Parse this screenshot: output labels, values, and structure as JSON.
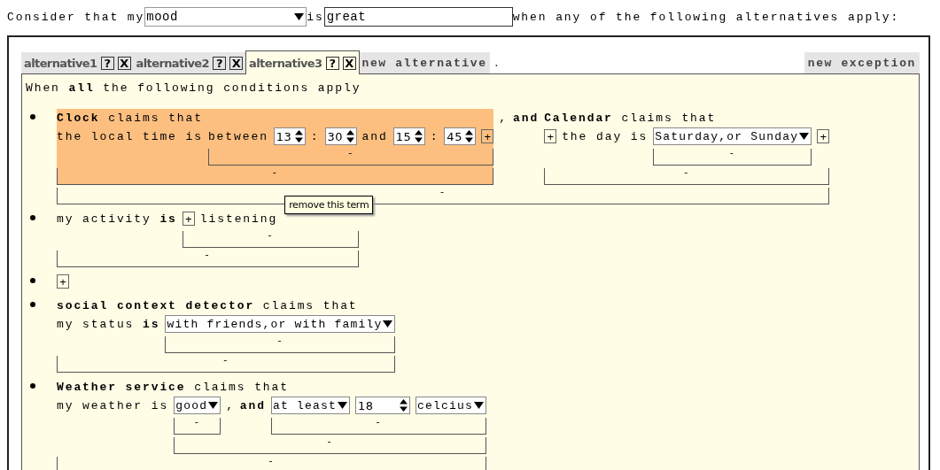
{
  "header": {
    "prefix": "Consider that my",
    "subject": "mood",
    "verb": "is",
    "value": "great",
    "suffix": "when any of the following alternatives apply:"
  },
  "tabs": [
    {
      "label": "alternative1",
      "help": "?",
      "close": "X",
      "selected": false
    },
    {
      "label": "alternative2",
      "help": "?",
      "close": "X",
      "selected": false
    },
    {
      "label": "alternative3",
      "help": "?",
      "close": "X",
      "selected": true
    }
  ],
  "new_alternative": "new alternative",
  "tab_dot": ".",
  "new_exception": "new exception",
  "intro": "When **all** the following conditions apply",
  "conditions": [
    {
      "kind": "term",
      "highlighted": false,
      "bracket": "-",
      "lines": [
        [
          {
            "kind": "term",
            "highlighted": true,
            "bracket": "-",
            "lines": [
              [
                {
                  "kind": "text",
                  "text": "**Clock** claims that"
                }
              ],
              [
                {
                  "kind": "text",
                  "text": "the local time is"
                },
                {
                  "kind": "term",
                  "highlighted": false,
                  "bracket": "-",
                  "lines": [
                    [
                      {
                        "kind": "text",
                        "text": "between"
                      },
                      {
                        "kind": "spinner",
                        "value": "13",
                        "wide": false
                      },
                      {
                        "kind": "text",
                        "text": ":"
                      },
                      {
                        "kind": "spinner",
                        "value": "30",
                        "wide": false
                      },
                      {
                        "kind": "text",
                        "text": "and"
                      },
                      {
                        "kind": "spinner",
                        "value": "15",
                        "wide": false
                      },
                      {
                        "kind": "text",
                        "text": ":"
                      },
                      {
                        "kind": "spinner",
                        "value": "45",
                        "wide": false
                      },
                      {
                        "kind": "add",
                        "label": "+"
                      }
                    ]
                  ]
                }
              ]
            ]
          },
          {
            "kind": "text",
            "text": ","
          },
          {
            "kind": "text",
            "text": "**and**"
          },
          {
            "kind": "term",
            "highlighted": false,
            "bracket": "-",
            "lines": [
              [
                {
                  "kind": "text",
                  "text": "**Calendar** claims that"
                }
              ],
              [
                {
                  "kind": "add",
                  "label": "+"
                },
                {
                  "kind": "text",
                  "text": "the day is"
                },
                {
                  "kind": "term",
                  "highlighted": false,
                  "bracket": "-",
                  "lines": [
                    [
                      {
                        "kind": "select",
                        "value": "Saturday,or Sunday"
                      }
                    ]
                  ]
                },
                {
                  "kind": "add",
                  "label": "+"
                }
              ]
            ]
          }
        ]
      ]
    },
    {
      "kind": "term",
      "highlighted": false,
      "bracket": "-",
      "lines": [
        [
          {
            "kind": "text",
            "text": "my activity **is**"
          },
          {
            "kind": "term",
            "highlighted": false,
            "bracket": "-",
            "lines": [
              [
                {
                  "kind": "add",
                  "label": "+"
                },
                {
                  "kind": "text",
                  "text": "listening"
                },
                {
                  "kind": "tooltip",
                  "text": "remove this term"
                }
              ]
            ]
          }
        ]
      ]
    },
    {
      "kind": "term",
      "highlighted": false,
      "lines": [
        [
          {
            "kind": "add",
            "label": "+"
          }
        ]
      ]
    },
    {
      "kind": "term",
      "highlighted": false,
      "bracket": "-",
      "lines": [
        [
          {
            "kind": "text",
            "text": "**social context detector** claims that"
          }
        ],
        [
          {
            "kind": "text",
            "text": "my status **is**"
          },
          {
            "kind": "term",
            "highlighted": false,
            "bracket": "-",
            "lines": [
              [
                {
                  "kind": "select",
                  "value": "with friends,or with family"
                }
              ]
            ]
          }
        ]
      ]
    },
    {
      "kind": "term",
      "highlighted": false,
      "bracket": "-",
      "lines": [
        [
          {
            "kind": "text",
            "text": "**Weather service** claims that"
          }
        ],
        [
          {
            "kind": "text",
            "text": "my weather is"
          },
          {
            "kind": "term",
            "highlighted": false,
            "bracket": "-",
            "lines": [
              [
                {
                  "kind": "term",
                  "highlighted": false,
                  "bracket": "-",
                  "lines": [
                    [
                      {
                        "kind": "select",
                        "value": "good"
                      }
                    ]
                  ]
                },
                {
                  "kind": "text",
                  "text": ","
                },
                {
                  "kind": "text",
                  "text": "**and**"
                },
                {
                  "kind": "term",
                  "highlighted": false,
                  "bracket": "-",
                  "lines": [
                    [
                      {
                        "kind": "select",
                        "value": "at least"
                      },
                      {
                        "kind": "spinner",
                        "value": "18",
                        "wide": true
                      },
                      {
                        "kind": "select",
                        "value": "celcius"
                      }
                    ]
                  ]
                }
              ]
            ]
          }
        ]
      ]
    }
  ]
}
